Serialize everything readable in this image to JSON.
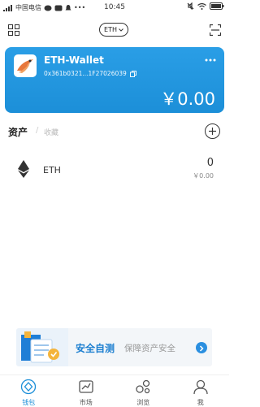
{
  "status_bar": {
    "carrier": "中国电信",
    "time": "10:45"
  },
  "header": {
    "network": "ETH"
  },
  "wallet": {
    "name": "ETH-Wallet",
    "address": "0x361b0321...1F27026039",
    "balance": "￥0.00"
  },
  "assets": {
    "tab_assets": "资产",
    "tab_separator": "/",
    "tab_favorites": "收藏",
    "items": [
      {
        "symbol": "ETH",
        "amount": "0",
        "value": "￥0.00"
      }
    ]
  },
  "banner": {
    "title": "安全自测",
    "subtitle": "保障资产安全"
  },
  "tabs": [
    {
      "label": "钱包",
      "icon": "wallet-icon",
      "active": true
    },
    {
      "label": "市场",
      "icon": "market-icon",
      "active": false
    },
    {
      "label": "浏览",
      "icon": "browse-icon",
      "active": false
    },
    {
      "label": "我",
      "icon": "profile-icon",
      "active": false
    }
  ],
  "colors": {
    "accent": "#1c8fd8",
    "card": "#2a9ee6",
    "banner_title": "#1c7fd0"
  }
}
